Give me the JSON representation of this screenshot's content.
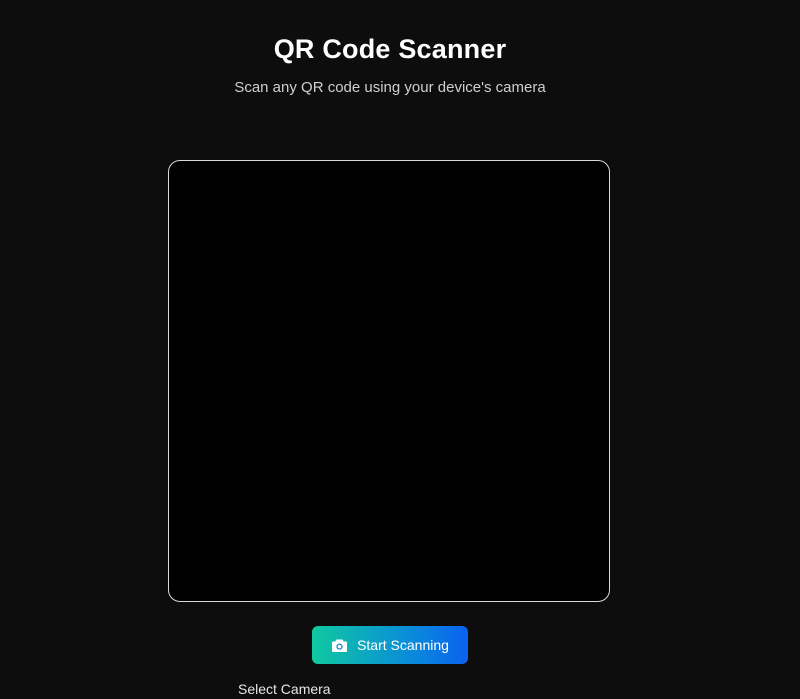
{
  "header": {
    "title": "QR Code Scanner",
    "subtitle": "Scan any QR code using your device's camera"
  },
  "scanner": {
    "start_label": "Start Scanning",
    "start_icon": "camera-icon",
    "select_camera_label": "Select Camera"
  },
  "colors": {
    "background": "#0d0d0d",
    "viewport": "#000000",
    "button_gradient_start": "#10c9a0",
    "button_gradient_end": "#0a62f0"
  }
}
